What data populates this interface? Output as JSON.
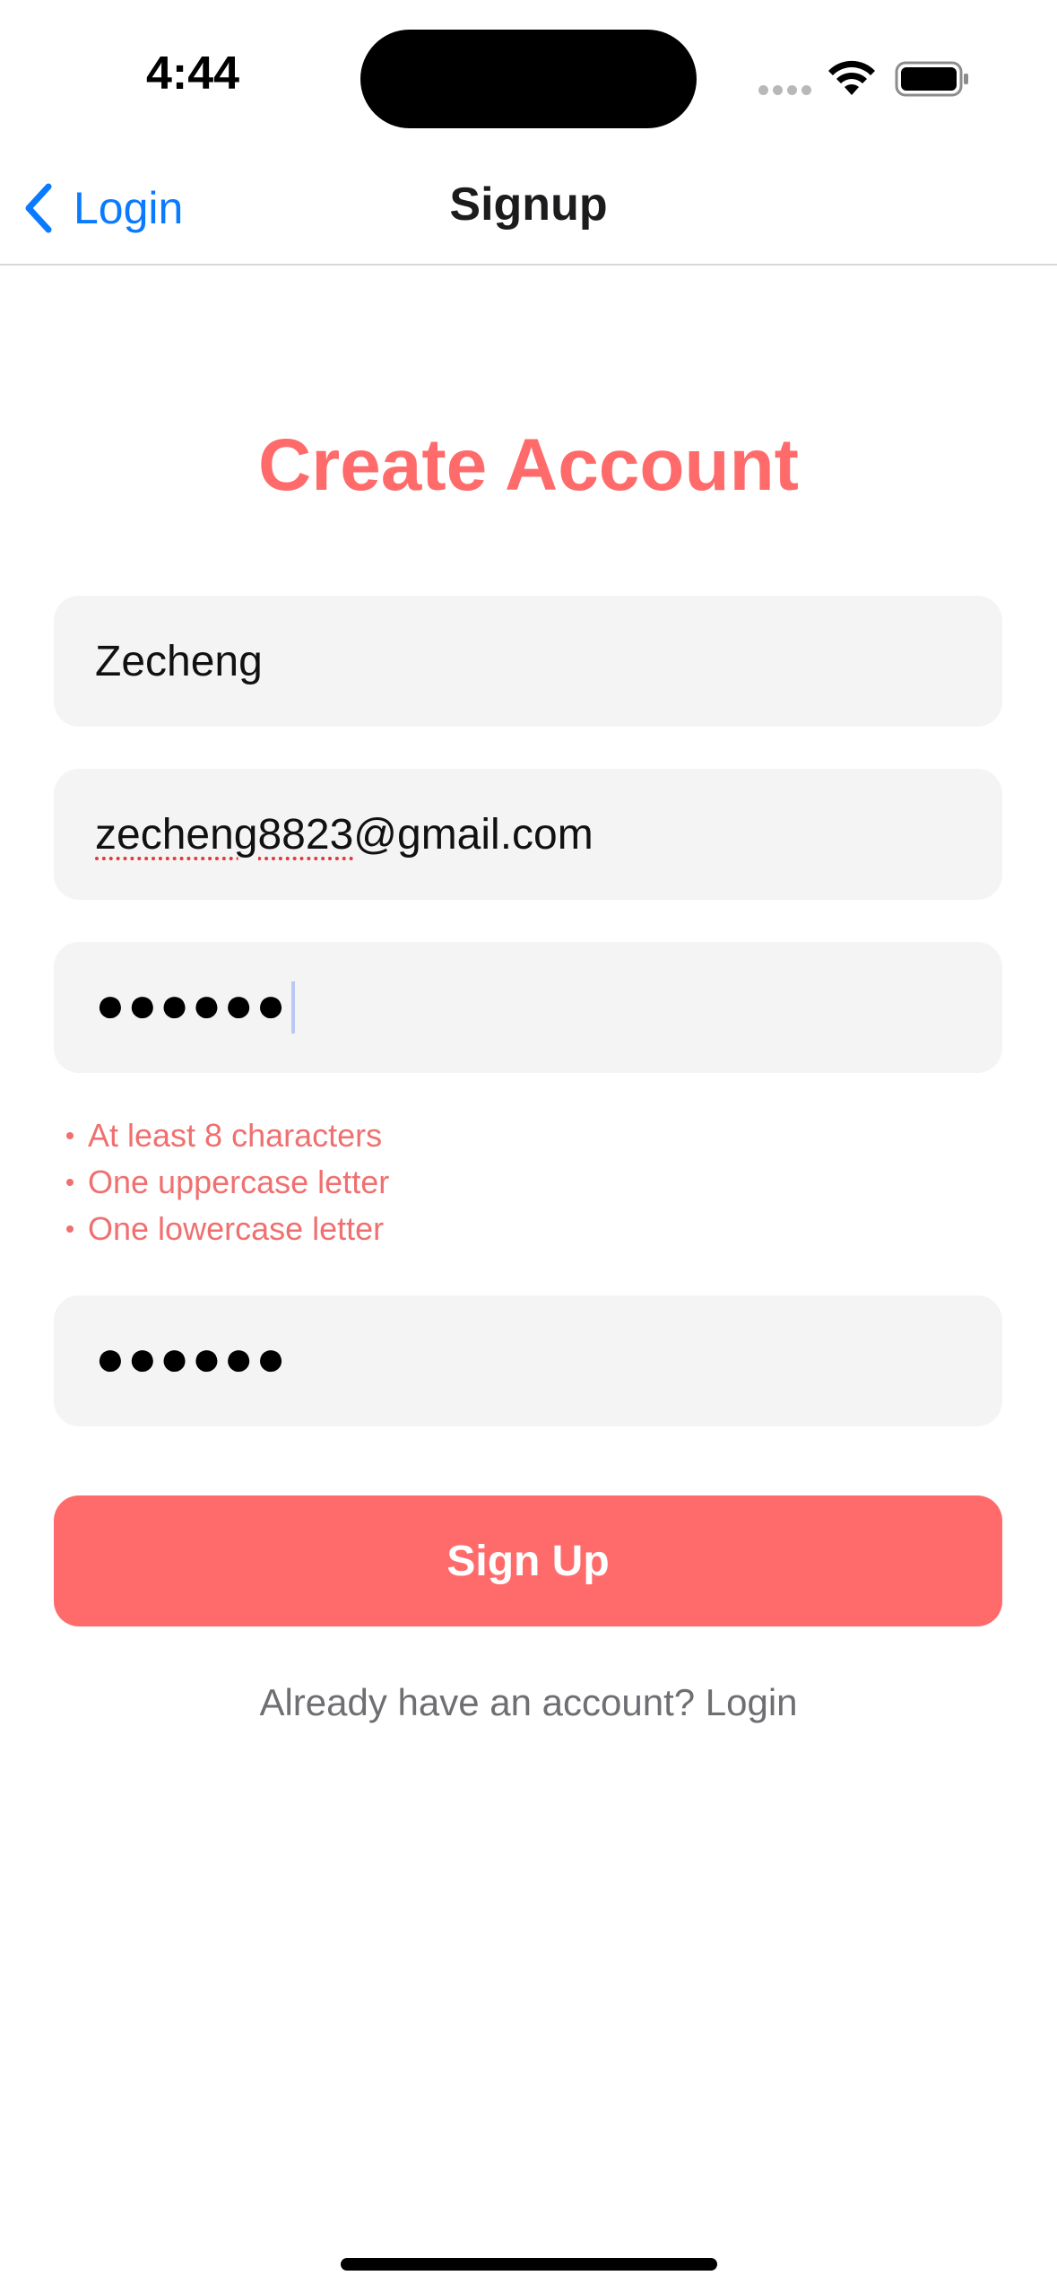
{
  "status_bar": {
    "time": "4:44",
    "icons": [
      "cellular-signal-icon",
      "wifi-icon",
      "battery-icon"
    ]
  },
  "nav_bar": {
    "back_label": "Login",
    "back_icon": "chevron-left-icon",
    "title": "Signup"
  },
  "form": {
    "heading": "Create Account",
    "name_value": "Zecheng",
    "email_misspelled_part": "zecheng8823",
    "email_rest": "@gmail.com",
    "password_mask": "●●●●●●",
    "password_requirements": [
      "At least 8 characters",
      "One uppercase letter",
      "One lowercase letter"
    ],
    "confirm_password_mask": "●●●●●●",
    "signup_button_label": "Sign Up",
    "login_prompt": "Already have an account? Login"
  },
  "colors": {
    "accent": "#ff6b6b",
    "link_blue": "#0a7aff",
    "field_background": "#f4f4f4",
    "requirement_text": "#f07070",
    "secondary_text": "#6e6e73"
  }
}
